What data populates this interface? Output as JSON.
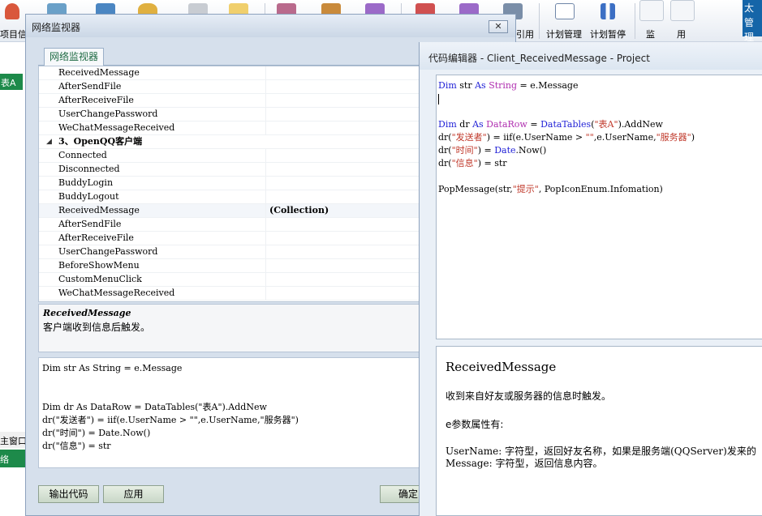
{
  "toolbar": {
    "left_label": "项目信息",
    "plan_manage": "计划管理",
    "plan_pause": "计划暂停",
    "quote": "引用",
    "monitor": "监",
    "use": "用",
    "right_badge": "太管理"
  },
  "left_tabs": {
    "table_a": "表A",
    "main_window": "主窗口",
    "network": "络"
  },
  "network_dialog": {
    "title": "网络监视器",
    "close_symbol": "✕",
    "tab_label": "网络监视器",
    "properties": [
      {
        "name": "ReceivedMessage",
        "value": ""
      },
      {
        "name": "AfterSendFile",
        "value": ""
      },
      {
        "name": "AfterReceiveFile",
        "value": ""
      },
      {
        "name": "UserChangePassword",
        "value": ""
      },
      {
        "name": "WeChatMessageReceived",
        "value": ""
      },
      {
        "name": "3、OpenQQ客户端",
        "value": "",
        "category": true
      },
      {
        "name": "Connected",
        "value": ""
      },
      {
        "name": "Disconnected",
        "value": ""
      },
      {
        "name": "BuddyLogin",
        "value": ""
      },
      {
        "name": "BuddyLogout",
        "value": ""
      },
      {
        "name": "ReceivedMessage",
        "value": "(Collection)",
        "selected": true
      },
      {
        "name": "AfterSendFile",
        "value": ""
      },
      {
        "name": "AfterReceiveFile",
        "value": ""
      },
      {
        "name": "UserChangePassword",
        "value": ""
      },
      {
        "name": "BeforeShowMenu",
        "value": ""
      },
      {
        "name": "CustomMenuClick",
        "value": ""
      },
      {
        "name": "WeChatMessageReceived",
        "value": ""
      }
    ],
    "description": {
      "title": "ReceivedMessage",
      "text": "客户端收到信息后触发。"
    },
    "code": "Dim str As String = e.Message\n\n\nDim dr As DataRow = DataTables(\"表A\").AddNew\ndr(\"发送者\") = iif(e.UserName > \"\",e.UserName,\"服务器\")\ndr(\"时间\") = Date.Now()\ndr(\"信息\") = str",
    "buttons": {
      "export": "输出代码",
      "apply": "应用",
      "ok": "确定"
    }
  },
  "code_editor": {
    "title": "代码编辑器 - Client_ReceivedMessage - Project",
    "help": {
      "title": "ReceivedMessage",
      "summary": "收到来自好友或服务器的信息时触发。",
      "params_header": "e参数属性有:",
      "param_username": "UserName: 字符型，返回好友名称，如果是服务端(QQServer)发来的",
      "param_message": "Message:  字符型，返回信息内容。"
    }
  }
}
